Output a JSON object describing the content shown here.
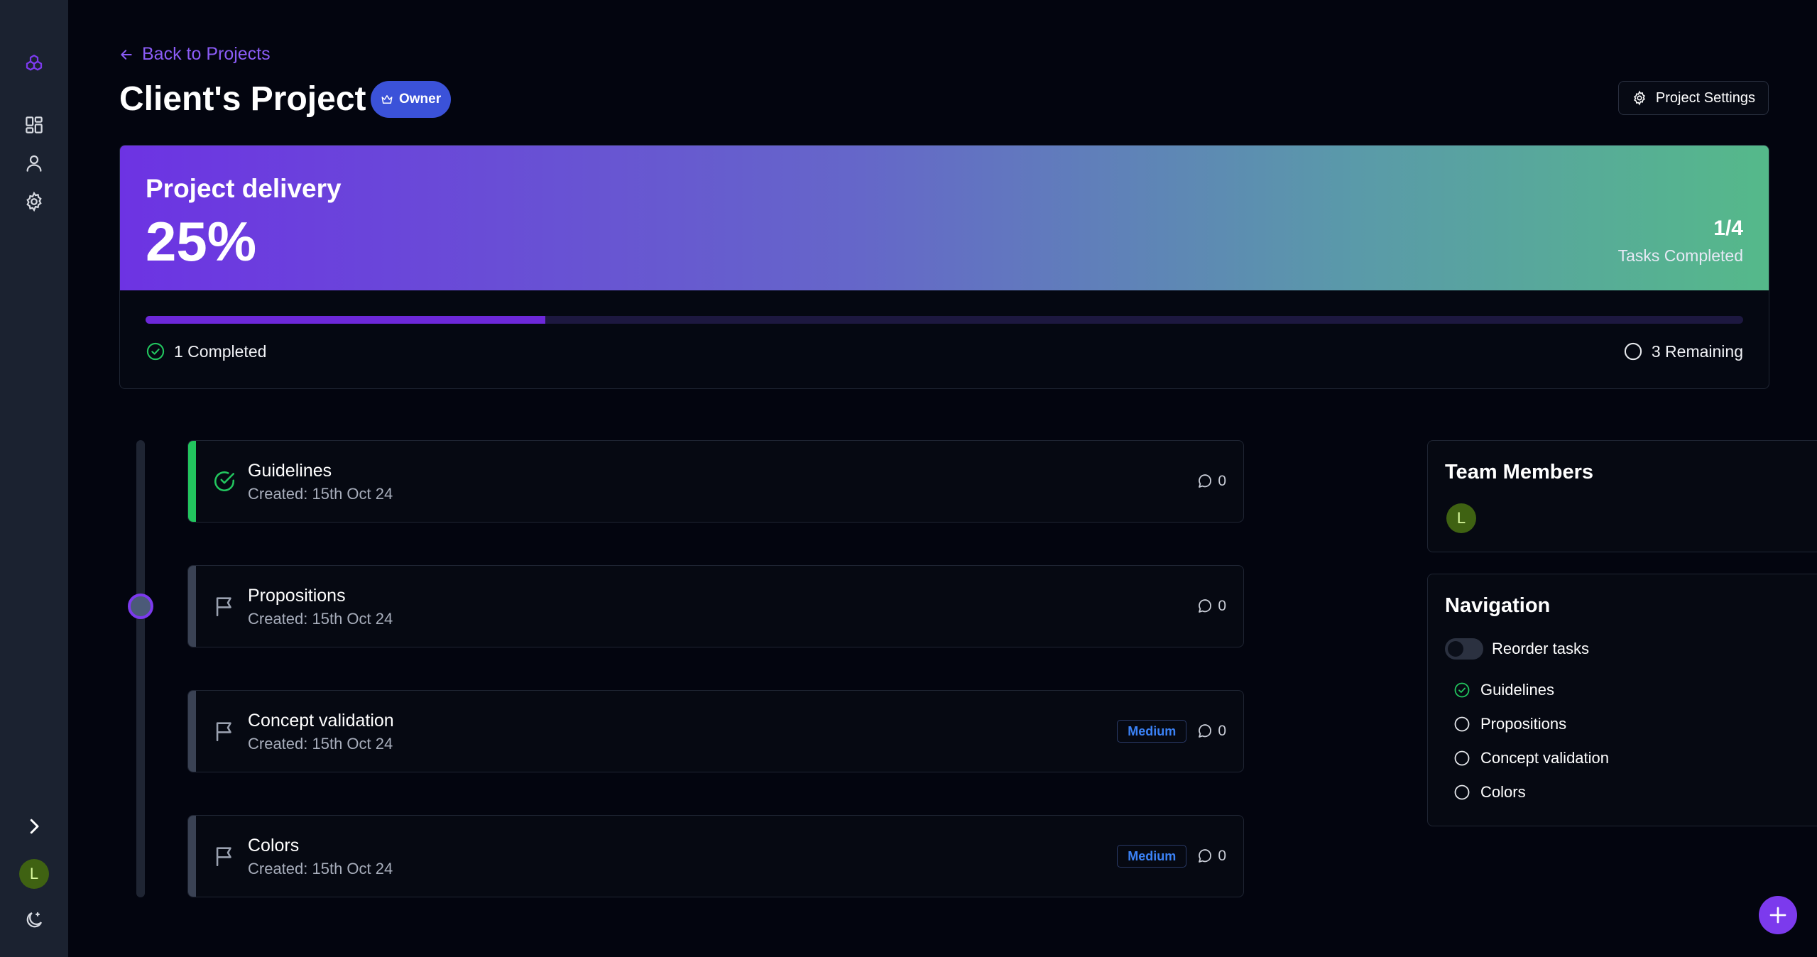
{
  "header": {
    "back_label": "Back to Projects",
    "title": "Client's Project",
    "owner_badge": "Owner",
    "settings_label": "Project Settings"
  },
  "progress": {
    "label": "Project delivery",
    "percent_text": "25%",
    "percent_value": 25,
    "count": "1/4",
    "count_label": "Tasks Completed",
    "completed_label": "1 Completed",
    "remaining_label": "3 Remaining"
  },
  "tasks": [
    {
      "title": "Guidelines",
      "date": "Created: 15th Oct 24",
      "priority": "",
      "comments": "0",
      "done": true
    },
    {
      "title": "Propositions",
      "date": "Created: 15th Oct 24",
      "priority": "",
      "comments": "0",
      "done": false
    },
    {
      "title": "Concept validation",
      "date": "Created: 15th Oct 24",
      "priority": "Medium",
      "comments": "0",
      "done": false
    },
    {
      "title": "Colors",
      "date": "Created: 15th Oct 24",
      "priority": "Medium",
      "comments": "0",
      "done": false
    }
  ],
  "team": {
    "title": "Team Members",
    "members": [
      "L"
    ]
  },
  "navigation": {
    "title": "Navigation",
    "reorder_label": "Reorder tasks",
    "items": [
      "Guidelines",
      "Propositions",
      "Concept validation",
      "Colors"
    ]
  },
  "user": {
    "avatar_letter": "L"
  },
  "icons": {
    "logo": "cubes-logo-icon",
    "dashboard": "dashboard-grid-icon",
    "profile": "user-icon",
    "settings": "gear-icon",
    "expand": "chevron-right-icon",
    "theme": "moon-icon",
    "add": "plus-icon"
  },
  "colors": {
    "accent": "#7c3aed",
    "success": "#22c55e",
    "priority": "#3b82f6",
    "sidebar": "#1b2230",
    "background": "#03050f"
  }
}
